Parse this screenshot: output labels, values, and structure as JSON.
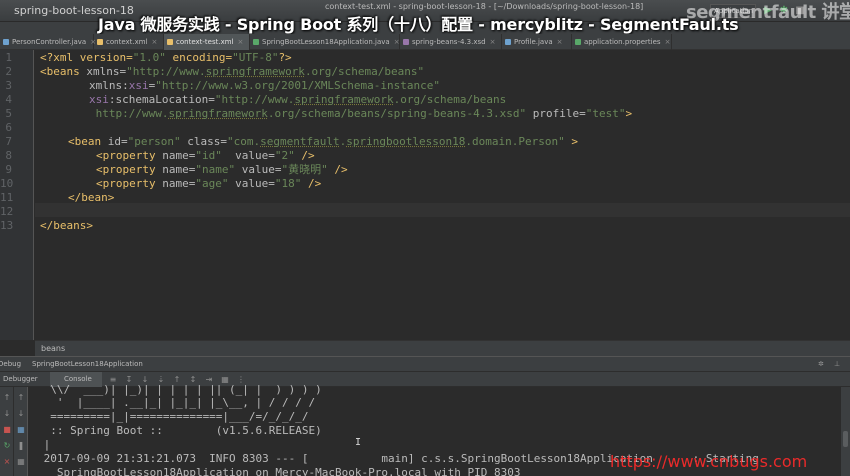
{
  "titlebar": {
    "project": "spring-boot-lesson-18",
    "window_title": "context-test.xml - spring-boot-lesson-18 - [~/Downloads/spring-boot-lesson-18]",
    "run_config": "Application",
    "run_icon": "▶",
    "debug_icon": "✱",
    "stop_icon": "■"
  },
  "watermark_brand": "segmentfault 讲堂",
  "overlay_title": "Java 微服务实践 - Spring Boot 系列（十八）配置 - mercyblitz - SegmentFaul.ts",
  "tabs": [
    {
      "label": "PersonController.java"
    },
    {
      "label": "context.xml"
    },
    {
      "label": "context-test.xml"
    },
    {
      "label": "SpringBootLesson18Application.java"
    },
    {
      "label": "spring-beans-4.3.xsd"
    },
    {
      "label": "Profile.java"
    },
    {
      "label": "application.properties"
    }
  ],
  "tab_close": "×",
  "editor": {
    "line_numbers": [
      "1",
      "2",
      "3",
      "4",
      "5",
      "6",
      "7",
      "8",
      "9",
      "10",
      "11",
      "12",
      "13"
    ],
    "l1": {
      "a": "<?xml version=",
      "b": "\"1.0\"",
      "c": " encoding=",
      "d": "\"UTF-8\"",
      "e": "?>"
    },
    "l2": {
      "a": "<beans ",
      "b": "xmlns=",
      "c": "\"http://www.springframework.org/schema/beans\""
    },
    "l3": {
      "a": "xmlns:",
      "b": "xsi",
      "c": "=",
      "d": "\"http://www.w3.org/2001/XMLSchema-instance\""
    },
    "l4": {
      "a": "xsi",
      "b": ":schemaLocation=",
      "c": "\"http://www.springframework.org/schema/beans"
    },
    "l5": {
      "a": " http://www.springframework.org/schema/beans/spring-beans-4.3.xsd\"",
      "b": " profile=",
      "c": "\"test\"",
      "d": ">"
    },
    "l7": {
      "a": "<bean ",
      "b": "id=",
      "c": "\"person\"",
      "d": " class=",
      "e": "\"com.segmentfault.springbootlesson18.domain.Person\"",
      "f": " >"
    },
    "l8": {
      "a": "<property ",
      "b": "name=",
      "c": "\"id\"",
      "d": "  value=",
      "e": "\"2\"",
      "f": " />"
    },
    "l9": {
      "a": "<property ",
      "b": "name=",
      "c": "\"name\"",
      "d": " value=",
      "e": "\"黄晓明\"",
      "f": " />"
    },
    "l10": {
      "a": "<property ",
      "b": "name=",
      "c": "\"age\"",
      "d": " value=",
      "e": "\"18\"",
      "f": " />"
    },
    "l11": "</bean>",
    "l13": "</beans>"
  },
  "breadcrumb": "beans",
  "debug": {
    "label": "Debug",
    "config": "SpringBootLesson18Application",
    "gear_icon": "✲",
    "hide_icon": "⊥",
    "tab_debugger": "Debugger",
    "tab_console": "Console",
    "tool_icons": [
      "≡",
      "↧",
      "↓",
      "⇣",
      "↑",
      "↕",
      "⇥",
      "▦",
      "⋮"
    ]
  },
  "sidebar_icons": {
    "up": "↑",
    "down": "↓",
    "stop": "■",
    "rerun": "↻",
    "pause": "❚",
    "grid": "▦",
    "close": "×"
  },
  "console": {
    "ascii1": "  \\\\/  ___)| |_)| | | | | || (_| |  ) ) ) )",
    "ascii2": "   '  |____| .__|_| |_|_| |_\\__, | / / / /",
    "ascii3": "  =========|_|==============|___/=/_/_/_/",
    "boot": "  :: Spring Boot ::        (v1.5.6.RELEASE)",
    "blank": " |",
    "log1": " 2017-09-09 21:31:21.073  INFO 8303 --- [           main] c.s.s.SpringBootLesson18Application      : Starting",
    "log2": "   SpringBootLesson18Application on Mercy-MacBook-Pro.local with PID 8303"
  },
  "url_watermark": "https://www.cnbugs.com",
  "cursor_glyph": "I"
}
